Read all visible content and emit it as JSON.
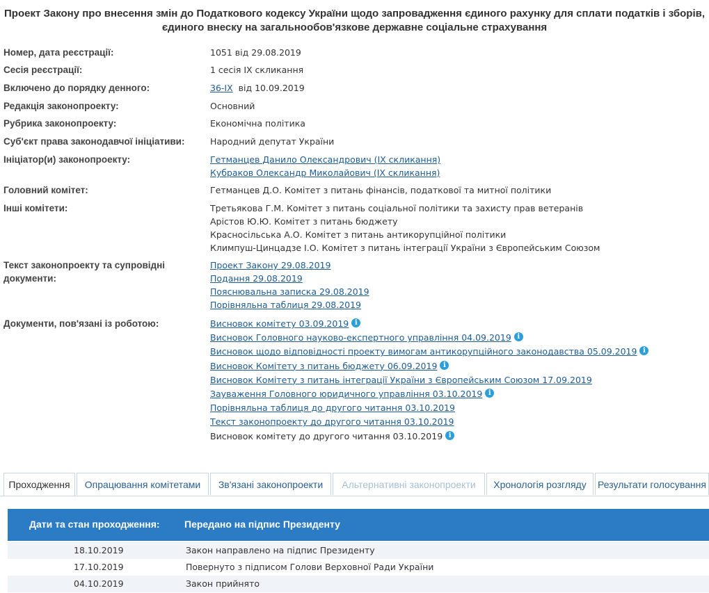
{
  "title": "Проект Закону про внесення змін до Податкового кодексу України щодо запровадження єдиного рахунку для сплати податків і зборів, єдиного внеску на загальнообов'язкове державне соціальне страхування",
  "fields": {
    "registration": {
      "label": "Номер, дата реєстрації:",
      "value": "1051 від 29.08.2019"
    },
    "session": {
      "label": "Сесія реєстрації:",
      "value": "1 сесія IX скликання"
    },
    "agenda": {
      "label": "Включено до порядку денного:",
      "link": "36-IX",
      "suffix": "від 10.09.2019"
    },
    "edition": {
      "label": "Редакція законопроекту:",
      "value": "Основний"
    },
    "rubric": {
      "label": "Рубрика законопроекту:",
      "value": "Економічна політика"
    },
    "subject": {
      "label": "Суб'єкт права законодавчої ініціативи:",
      "value": "Народний депутат України"
    },
    "initiators": {
      "label": "Ініціатор(и) законопроекту:",
      "items": [
        "Гетманцев Данило Олександрович (IX скликання)",
        "Кубраков Олександр Миколайович (IX скликання)"
      ]
    },
    "main_committee": {
      "label": "Головний комітет:",
      "value": "Гетманцев Д.О. Комітет з питань фінансів, податкової та митної політики"
    },
    "other_committees": {
      "label": "Інші комітети:",
      "items": [
        "Третьякова Г.М. Комітет з питань соціальної політики та захисту прав ветеранів",
        "Арістов Ю.Ю. Комітет з питань бюджету",
        "Красносільська А.О. Комітет з питань антикорупційної політики",
        "Климпуш-Цинцадзе І.О. Комітет з питань інтеграції України з Європейським Союзом"
      ]
    },
    "texts": {
      "label_line1": "Текст законопроекту та супровідні",
      "label_line2": "документи:",
      "items": [
        "Проект Закону 29.08.2019",
        "Подання 29.08.2019",
        "Пояснювальна записка 29.08.2019",
        "Порівняльна таблиця 29.08.2019"
      ]
    },
    "related_docs": {
      "label": "Документи, пов'язані із роботою:",
      "items": [
        "Висновок комітету 03.09.2019",
        "Висновок Головного науково-експертного управління 04.09.2019",
        "Висновок щодо відповідності проекту вимогам антикорупційного законодавства 05.09.2019",
        "Висновок Комітету з питань бюджету 06.09.2019",
        "Висновок Комітету з питань інтеграції України з Європейським Союзом 17.09.2019",
        "Зауваження Головного юридичного управління 03.10.2019",
        "Порівняльна таблиця до другого читання 03.10.2019",
        "Текст законопроекту до другого читання 03.10.2019",
        "Висновок комітету до другого читання 03.10.2019"
      ]
    }
  },
  "tabs": [
    "Проходження",
    "Опрацювання комітетами",
    "Зв'язані законопроекти",
    "Альтернативні законопроекти",
    "Хронологія розгляду",
    "Результати голосування"
  ],
  "progress": {
    "header_label": "Дати та стан проходження:",
    "header_status": "Передано на підпис Президенту",
    "rows": [
      {
        "date": "18.10.2019",
        "status": "Закон направлено на підпис Президенту"
      },
      {
        "date": "17.10.2019",
        "status": "Повернуто з підписом Голови Верховної Ради України"
      },
      {
        "date": "04.10.2019",
        "status": "Закон прийнято"
      }
    ]
  },
  "colors": {
    "accent": "#2b7cc5",
    "link": "#1d5b96",
    "info_icon": "#2b9fdc"
  }
}
